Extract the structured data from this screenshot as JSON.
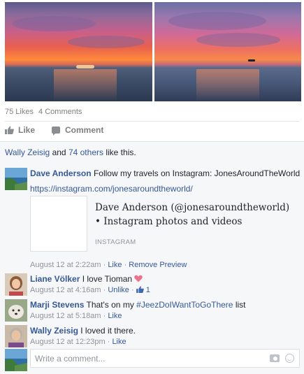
{
  "post": {
    "likes_count": "75 Likes",
    "comments_count": "4 Comments",
    "actions": {
      "like": "Like",
      "comment": "Comment"
    }
  },
  "likers": {
    "name": "Wally Zeisig",
    "connector": "and",
    "others": "74 others",
    "suffix": "like this."
  },
  "comments": [
    {
      "author": "Dave Anderson",
      "text": "Follow my travels on Instagram: JonesAroundTheWorld",
      "link": "https://instagram.com/jonesaroundtheworld/",
      "preview": {
        "title": "Dave Anderson (@jonesaroundtheworld) • Instagram photos and videos",
        "source": "INSTAGRAM"
      },
      "timestamp": "August 12 at 2:22am",
      "like": "Like",
      "remove_preview": "Remove Preview"
    },
    {
      "author": "Liane Völker",
      "text": "I love Tioman",
      "emoji": "heart",
      "timestamp": "August 12 at 4:16am",
      "unlike": "Unlike",
      "like_count": "1"
    },
    {
      "author": "Marji Stevens",
      "text_before": "That's on my",
      "hashtag": "#JeezDoIWantToGoThere",
      "text_after": "list",
      "timestamp": "August 12 at 5:18am",
      "like": "Like"
    },
    {
      "author": "Wally Zeisig",
      "text": "I loved it there.",
      "timestamp": "August 12 at 12:23pm",
      "like": "Like"
    }
  ],
  "composer": {
    "placeholder": "Write a comment..."
  },
  "separator": "·",
  "colors": {
    "link": "#365899",
    "meta": "#90949c",
    "background": "#f6f7f9",
    "heart": "#e9738c"
  }
}
